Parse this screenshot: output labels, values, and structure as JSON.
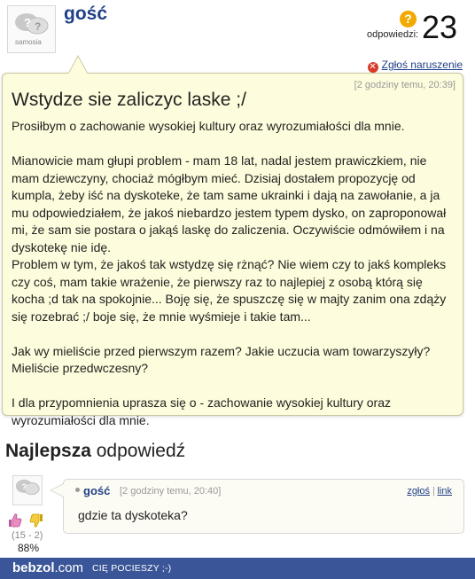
{
  "question_author": {
    "name": "gość",
    "avatar_text": "samosia"
  },
  "answers": {
    "label": "odpowiedzi:",
    "count": "23",
    "badge_icon": "question-mark",
    "badge_glyph": "?"
  },
  "report": {
    "icon": "close-circle-icon",
    "label": "Zgłoś naruszenie"
  },
  "question": {
    "time": "[2 godziny temu, 20:39]",
    "title": "Wstydze sie zaliczyc laske ;/",
    "paragraphs": [
      "Prosiłbym o zachowanie wysokiej kultury oraz wyrozumiałości dla mnie.",
      "",
      "Mianowicie mam głupi problem - mam 18 lat, nadal jestem prawiczkiem, nie mam dziewczyny, chociaż mógłbym mieć. Dzisiaj dostałem propozycję od kumpla, żeby iść na dyskoteke, że tam same ukrainki i dają na zawołanie, a ja mu odpowiedziałem, że jakoś niebardzo jestem typem dysko, on zaproponował mi, że sam sie postara o jakąś laskę do zaliczenia. Oczywiście odmówiłem i na dyskotekę nie idę.",
      "Problem w tym, że jakoś tak wstydzę się rżnąć? Nie wiem czy to jakś kompleks czy coś, mam takie wrażenie, że pierwszy raz to najlepiej z osobą którą się kocha ;d tak na spokojnie... Boję się, że spuszczę się w majty zanim ona zdąży się rozebrać ;/ boje się, że mnie wyśmieje i takie tam...",
      "",
      "Jak wy mieliście przed pierwszym razem? Jakie uczucia wam towarzyszyły? Mieliście przedwczesny?",
      "",
      "I dla przypomnienia uprasza się o - zachowanie wysokiej kultury oraz wyrozumiałości dla mnie."
    ]
  },
  "best_answer": {
    "heading_bold": "Najlepsza",
    "heading_rest": " odpowiedź",
    "author": "gość",
    "time": "[2 godziny temu, 20:40]",
    "report_label": "zgłoś",
    "separator": "|",
    "link_label": "link",
    "text": "gdzie ta dyskoteka?",
    "votes": "(15 - 2)",
    "percent": "88%"
  },
  "footer": {
    "logo_main": "bebzol",
    "logo_suffix": ".com",
    "tagline": "CIĘ POCIESZY ;-)"
  },
  "colors": {
    "link_blue": "#1f3f86",
    "question_bg": "#fdfcdc",
    "footer_bg": "#3b5698",
    "badge_orange": "#f2a900",
    "report_red": "#d93a2b"
  }
}
